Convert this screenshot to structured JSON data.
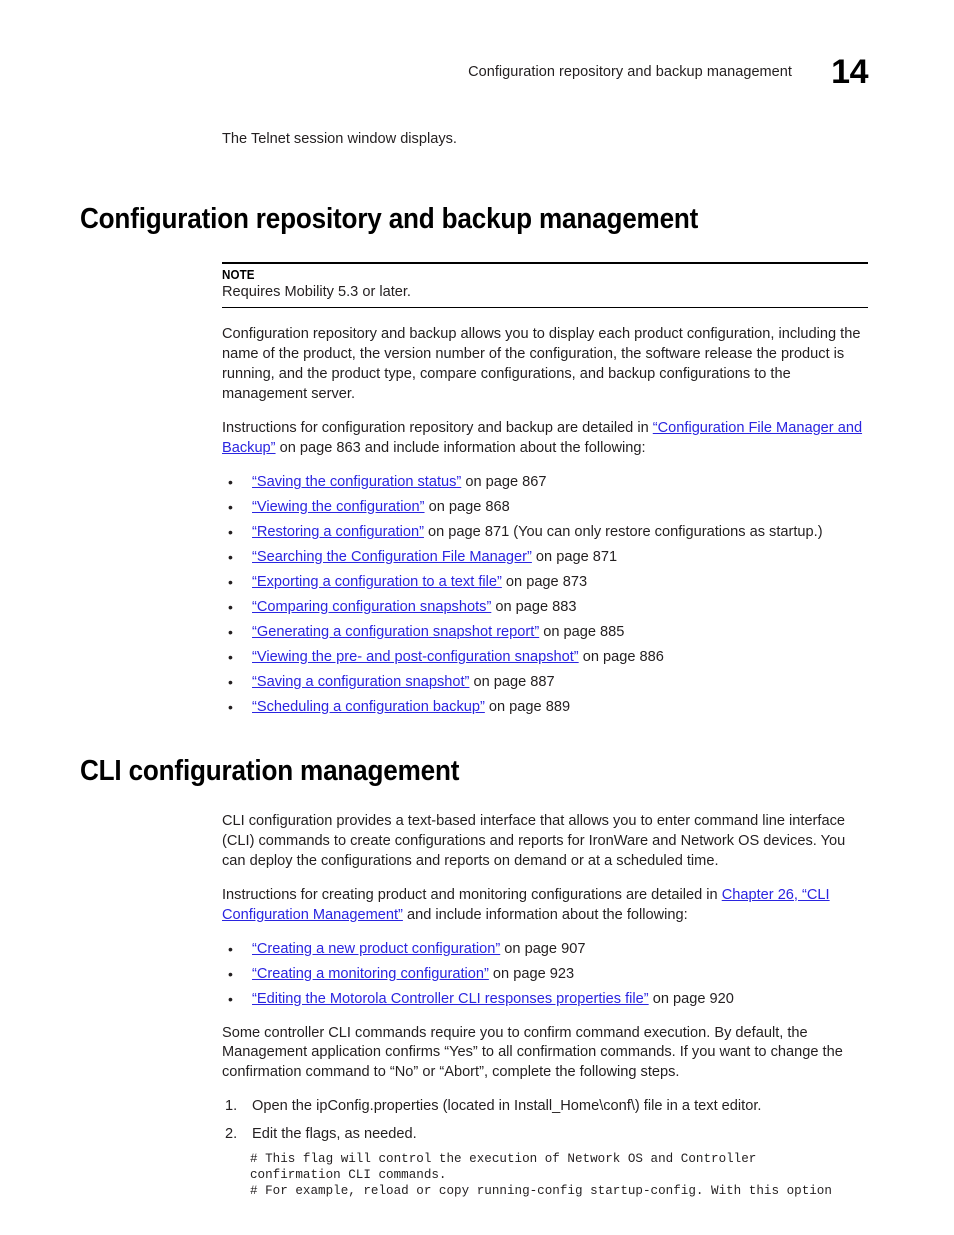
{
  "header": {
    "running_title": "Configuration repository and backup management",
    "chapter_number": "14"
  },
  "intro": {
    "telnet_line": "The Telnet session window displays."
  },
  "section1": {
    "heading": "Configuration repository and backup management",
    "note": {
      "label": "NOTE",
      "text": "Requires Mobility 5.3 or later."
    },
    "paragraph1": "Configuration repository and backup allows you to display each product configuration, including the name of the product, the version number of the configuration, the software release the product is running, and the product type, compare configurations, and backup configurations to the management server.",
    "paragraph2_pre": "Instructions for configuration repository and backup are detailed in ",
    "paragraph2_link": "“Configuration File Manager and Backup”",
    "paragraph2_post": " on page 863 and include information about the following:",
    "bullets": [
      {
        "bullet": "•",
        "link": "“Saving the configuration status”",
        "rest": " on page 867"
      },
      {
        "bullet": "•",
        "link": "“Viewing the configuration”",
        "rest": " on page 868"
      },
      {
        "bullet": "•",
        "link": "“Restoring a configuration”",
        "rest": " on page 871 (You can only restore configurations as startup.)"
      },
      {
        "bullet": "•",
        "link": "“Searching the Configuration File Manager”",
        "rest": " on page 871"
      },
      {
        "bullet": "•",
        "link": "“Exporting a configuration to a text file”",
        "rest": " on page 873"
      },
      {
        "bullet": "•",
        "link": "“Comparing configuration snapshots”",
        "rest": " on page 883"
      },
      {
        "bullet": "•",
        "link": "“Generating a configuration snapshot report”",
        "rest": " on page 885"
      },
      {
        "bullet": "•",
        "link": "“Viewing the pre- and post-configuration snapshot”",
        "rest": " on page 886"
      },
      {
        "bullet": "•",
        "link": "“Saving a configuration snapshot”",
        "rest": " on page 887"
      },
      {
        "bullet": "•",
        "link": "“Scheduling a configuration backup”",
        "rest": " on page 889"
      }
    ]
  },
  "section2": {
    "heading": "CLI configuration management",
    "paragraph1": "CLI configuration provides a text-based interface that allows you to enter command line interface (CLI) commands to create configurations and reports for IronWare and Network OS devices. You can deploy the configurations and reports on demand or at a scheduled time.",
    "paragraph2_pre": "Instructions for creating product and monitoring configurations are detailed in ",
    "paragraph2_link": "Chapter 26, “CLI Configuration Management”",
    "paragraph2_post": " and include information about the following:",
    "bullets": [
      {
        "bullet": "•",
        "link": "“Creating a new product configuration”",
        "rest": " on page 907"
      },
      {
        "bullet": "•",
        "link": "“Creating a monitoring configuration”",
        "rest": " on page 923"
      },
      {
        "bullet": "•",
        "link": "“Editing the Motorola Controller CLI responses properties file”",
        "rest": " on page 920"
      }
    ],
    "paragraph3": "Some controller CLI commands require you to confirm command execution. By default, the Management application confirms “Yes” to all confirmation commands. If you want to change the confirmation command to “No” or “Abort”, complete the following steps.",
    "steps": [
      {
        "num": "1.",
        "text": "Open the ipConfig.properties (located in Install_Home\\conf\\) file in a text editor."
      },
      {
        "num": "2.",
        "text": "Edit the flags, as needed."
      }
    ],
    "code_block": "# This flag will control the execution of Network OS and Controller\nconfirmation CLI commands.\n# For example, reload or copy running-config startup-config. With this option"
  },
  "colors": {
    "link": "#2a24e0",
    "text": "#231f20",
    "rule": "#000000"
  }
}
